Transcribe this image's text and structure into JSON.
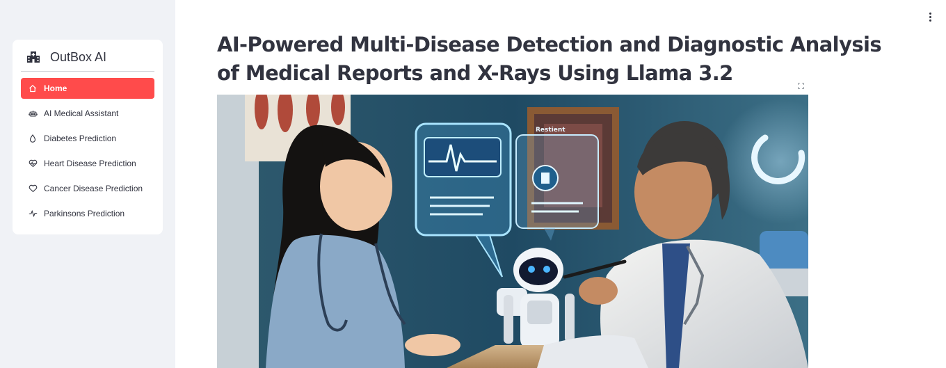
{
  "sidebar": {
    "brand": {
      "name": "OutBox AI",
      "icon": "hospital-icon"
    },
    "active_color": "#ff4b4b",
    "items": [
      {
        "label": "Home",
        "icon": "house-icon",
        "active": true
      },
      {
        "label": "AI Medical Assistant",
        "icon": "robot-icon",
        "active": false
      },
      {
        "label": "Diabetes Prediction",
        "icon": "droplet-icon",
        "active": false
      },
      {
        "label": "Heart Disease Prediction",
        "icon": "heart-pulse-icon",
        "active": false
      },
      {
        "label": "Cancer Disease Prediction",
        "icon": "heart-icon",
        "active": false
      },
      {
        "label": "Parkinsons Prediction",
        "icon": "activity-icon",
        "active": false
      }
    ]
  },
  "main": {
    "title": "AI-Powered Multi-Disease Detection and Diagnostic Analysis of Medical Reports and X-Rays Using Llama 3.2",
    "hero_image": {
      "description_icon": "image",
      "screen_label": "Restient"
    }
  }
}
